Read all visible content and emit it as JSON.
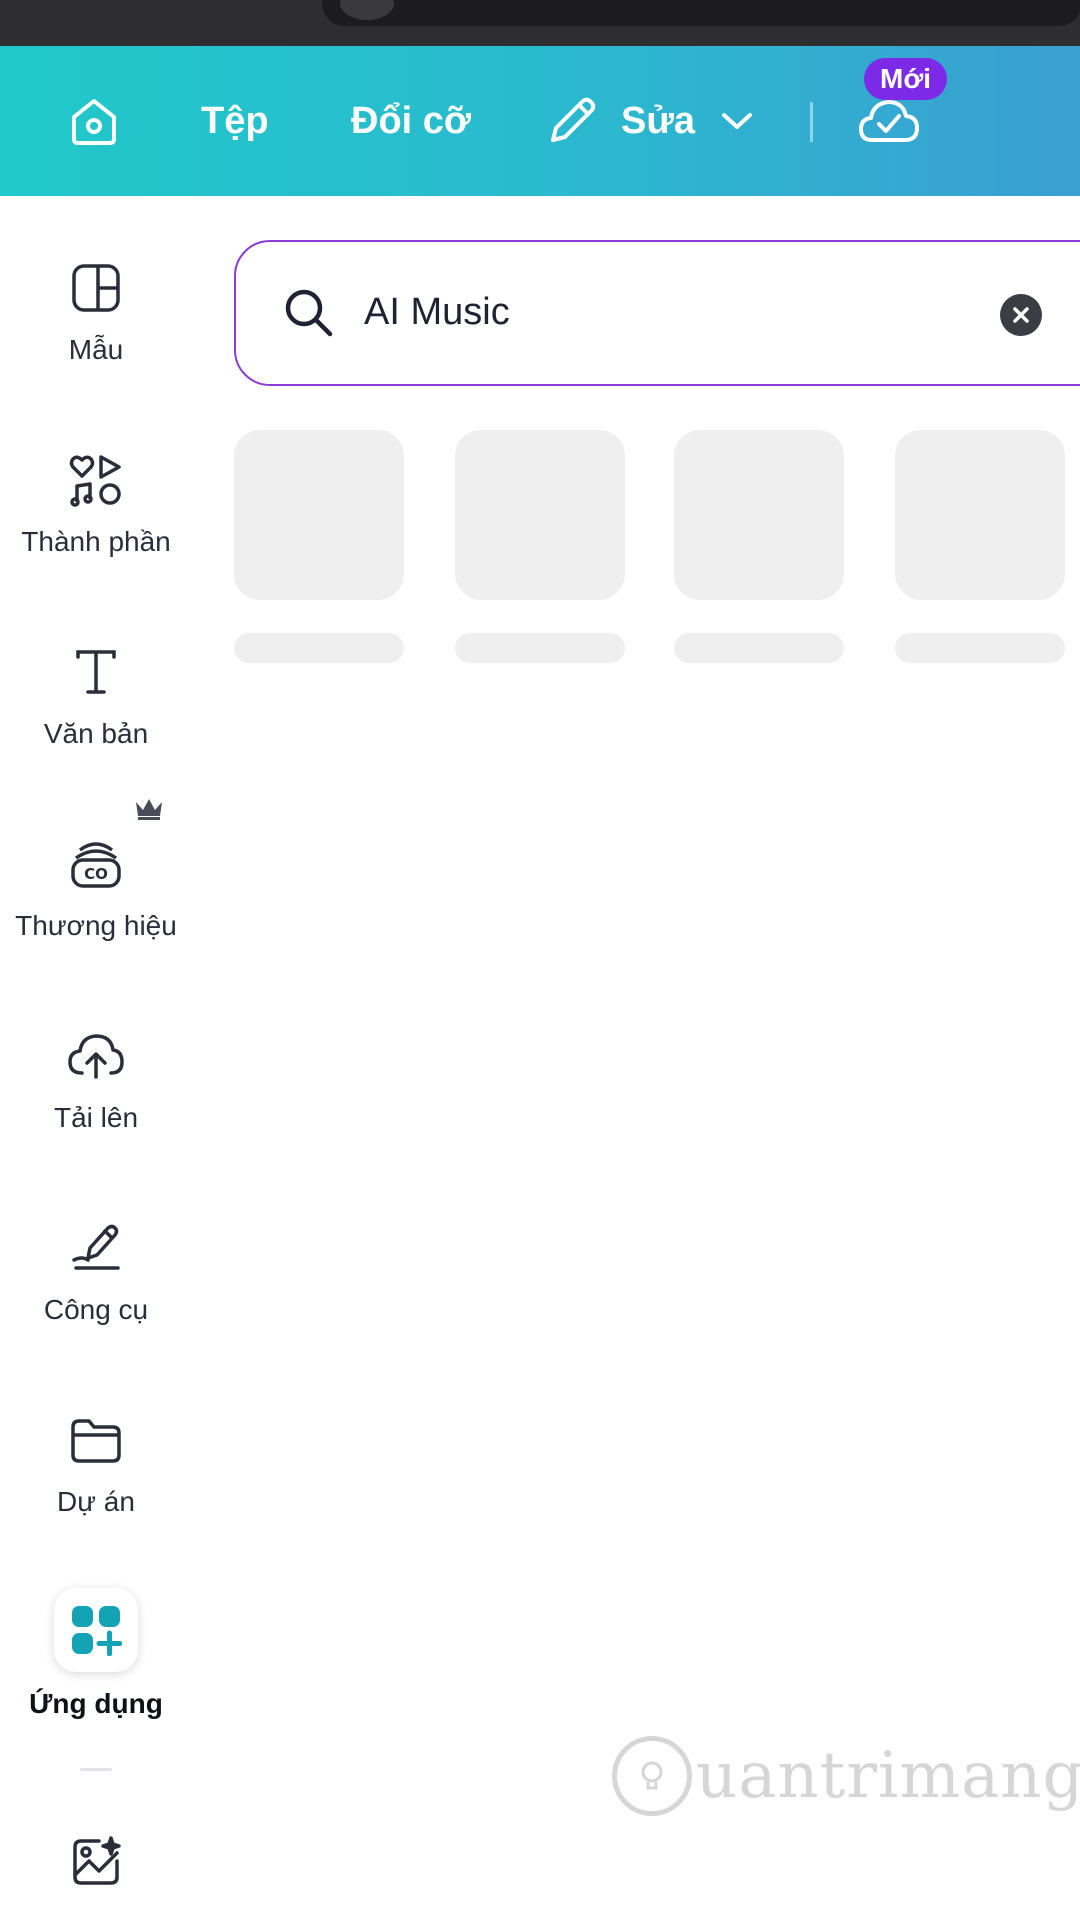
{
  "header": {
    "home_icon": "home-icon",
    "file_label": "Tệp",
    "resize_label": "Đổi cỡ",
    "edit_label": "Sửa",
    "new_badge": "Mới"
  },
  "sidebar": {
    "items": [
      {
        "label": "Mẫu",
        "icon": "template-icon"
      },
      {
        "label": "Thành phần",
        "icon": "elements-icon"
      },
      {
        "label": "Văn bản",
        "icon": "text-icon"
      },
      {
        "label": "Thương hiệu",
        "icon": "brand-icon",
        "premium": true
      },
      {
        "label": "Tải lên",
        "icon": "upload-icon"
      },
      {
        "label": "Công cụ",
        "icon": "draw-icon"
      },
      {
        "label": "Dự án",
        "icon": "folder-icon"
      },
      {
        "label": "Ứng dụng",
        "icon": "apps-icon",
        "active": true
      },
      {
        "label": "",
        "icon": "magic-media-icon"
      }
    ]
  },
  "search": {
    "value": "AI Music"
  },
  "watermark": {
    "text": "uantrimang"
  },
  "colors": {
    "header_gradient_start": "#20c9c9",
    "header_gradient_end": "#3a9fd2",
    "accent_purple": "#7d2ae8",
    "apps_teal": "#13a3b5"
  }
}
